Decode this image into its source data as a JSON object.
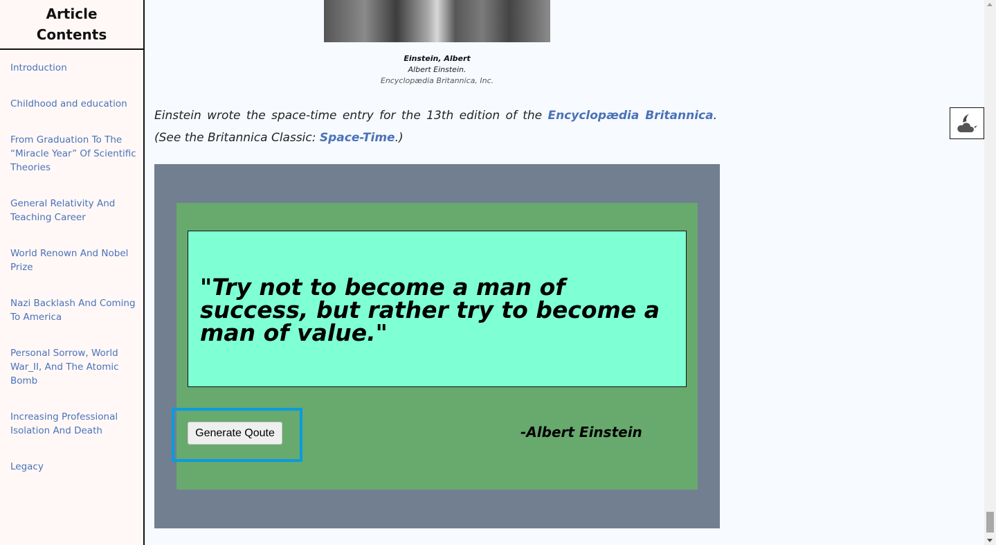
{
  "sidebar": {
    "title": "Article Contents",
    "items": [
      {
        "label": "Introduction"
      },
      {
        "label": "Childhood and education"
      },
      {
        "label": "From Graduation To The “Miracle Year” Of Scientific Theories"
      },
      {
        "label": "General Relativity And Teaching Career"
      },
      {
        "label": "World Renown And Nobel Prize"
      },
      {
        "label": "Nazi Backlash And Coming To America"
      },
      {
        "label": "Personal Sorrow, World War_II, And The Atomic Bomb"
      },
      {
        "label": "Increasing Professional Isolation And Death"
      },
      {
        "label": "Legacy"
      }
    ]
  },
  "figure": {
    "caption_title": "Einstein, Albert",
    "caption_subtitle": "Albert Einstein.",
    "caption_credit": "Encyclopædia Britannica, Inc."
  },
  "article": {
    "text_1": "Einstein wrote the space-time entry for the 13th edition of the ",
    "link_1": "Encyclopædia Britannica",
    "text_2": ". (See the Britannica Classic: ",
    "link_2": "Space-Time",
    "text_3": ".)"
  },
  "quote": {
    "text": "\"Try not to become a man of success, but rather try to become a man of value.\"",
    "author": "-Albert Einstein",
    "button_label": "Generate Qoute"
  },
  "colors": {
    "outer_panel": "#717f90",
    "inner_panel": "#68a96e",
    "quote_box": "#7fffd4",
    "link": "#4a72b8",
    "highlight": "#0a9be0"
  },
  "icons": {
    "theme_toggle": "moon-cloud-icon"
  }
}
